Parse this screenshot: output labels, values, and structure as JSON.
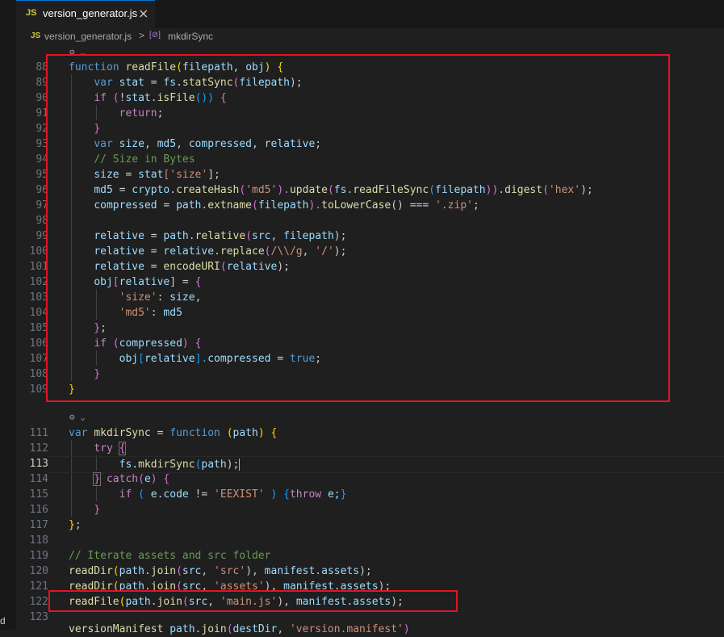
{
  "tab": {
    "badge": "JS",
    "title": "version_generator.js",
    "close": "×"
  },
  "breadcrumb": {
    "badge": "JS",
    "file": "version_generator.js",
    "separator": ">",
    "symbol_icon": "[⊘]",
    "symbol": "mkdirSync"
  },
  "codelens": {
    "icon": "⚙",
    "chevron": "⌄"
  },
  "stray_char": "d",
  "gutter": {
    "l88": "88",
    "l89": "89",
    "l90": "90",
    "l91": "91",
    "l92": "92",
    "l93": "93",
    "l94": "94",
    "l95": "95",
    "l96": "96",
    "l97": "97",
    "l98": "98",
    "l99": "99",
    "l100": "100",
    "l101": "101",
    "l102": "102",
    "l103": "103",
    "l104": "104",
    "l105": "105",
    "l106": "106",
    "l107": "107",
    "l108": "108",
    "l109": "109",
    "l111": "111",
    "l112": "112",
    "l113": "113",
    "l114": "114",
    "l115": "115",
    "l116": "116",
    "l117": "117",
    "l118": "118",
    "l119": "119",
    "l120": "120",
    "l121": "121",
    "l122": "122",
    "l123": "123"
  },
  "code": {
    "l88": [
      "function",
      "readFile",
      "(",
      "filepath",
      ", ",
      "obj",
      ") ",
      "{"
    ],
    "l89": [
      "    ",
      "var",
      "stat",
      " = ",
      "fs",
      ".",
      "statSync",
      "(",
      "filepath",
      ");"
    ],
    "l90": [
      "    ",
      "if",
      " (",
      "!",
      "stat",
      ".",
      "isFile",
      "()) ",
      "{"
    ],
    "l91": [
      "        ",
      "return",
      ";"
    ],
    "l92": [
      "    ",
      "}"
    ],
    "l93": [
      "    ",
      "var",
      "size",
      ", ",
      "md5",
      ", ",
      "compressed",
      ", ",
      "relative",
      ";"
    ],
    "l94": [
      "    ",
      "// Size in Bytes"
    ],
    "l95": [
      "    ",
      "size",
      " = ",
      "stat",
      "['size'",
      "];"
    ],
    "l96": [
      "    ",
      "md5",
      " = ",
      "crypto",
      ".",
      "createHash",
      "(",
      "'md5'",
      ").",
      "update",
      "(",
      "fs",
      ".",
      "readFileSync",
      "(",
      "filepath",
      "))",
      ".",
      "digest",
      "(",
      "'hex'",
      ");"
    ],
    "l97": [
      "    ",
      "compressed",
      " = ",
      "path",
      ".",
      "extname",
      "(",
      "filepath",
      ").",
      "toLowerCase",
      "() === ",
      "'.zip'",
      ";"
    ],
    "l99": [
      "    ",
      "relative",
      " = ",
      "path",
      ".",
      "relative",
      "(",
      "src",
      ", ",
      "filepath",
      ");"
    ],
    "l100": [
      "    ",
      "relative",
      " = ",
      "relative",
      ".",
      "replace",
      "(",
      "/\\\\/g",
      ", ",
      "'/'",
      ");"
    ],
    "l101": [
      "    ",
      "relative",
      " = ",
      "encodeURI",
      "(",
      "relative",
      ");"
    ],
    "l102": [
      "    ",
      "obj",
      "[",
      "relative",
      "] = ",
      "{"
    ],
    "l103": [
      "        ",
      "'size'",
      ": ",
      "size",
      ","
    ],
    "l104": [
      "        ",
      "'md5'",
      ": ",
      "md5"
    ],
    "l105": [
      "    ",
      "}",
      ";"
    ],
    "l106": [
      "    ",
      "if",
      " (",
      "compressed",
      ") ",
      "{"
    ],
    "l107": [
      "        ",
      "obj",
      "[",
      "relative",
      "].",
      "compressed",
      " = ",
      "true",
      ";"
    ],
    "l108": [
      "    ",
      "}"
    ],
    "l109": [
      "}"
    ],
    "l111": [
      "var ",
      "mkdirSync",
      " = ",
      "function",
      " (",
      "path",
      ") ",
      "{"
    ],
    "l112": [
      "    ",
      "try",
      " ",
      "{"
    ],
    "l113": [
      "        ",
      "fs",
      ".",
      "mkdirSync",
      "(",
      "path",
      ");"
    ],
    "l114": [
      "    ",
      "}",
      " ",
      "catch",
      "(",
      "e",
      ") ",
      "{"
    ],
    "l115": [
      "        ",
      "if",
      " ( ",
      "e",
      ".",
      "code",
      " != ",
      "'EEXIST'",
      " ) ",
      "{",
      "throw",
      " e;",
      "}"
    ],
    "l116": [
      "    ",
      "}"
    ],
    "l117": [
      "}",
      ";"
    ],
    "l119": [
      "// Iterate assets and src folder"
    ],
    "l120": [
      "readDir",
      "(",
      "path",
      ".",
      "join",
      "(",
      "src",
      ", ",
      "'src'",
      "), ",
      "manifest",
      ".",
      "assets",
      ");"
    ],
    "l121": [
      "readDir",
      "(",
      "path",
      ".",
      "join",
      "(",
      "src",
      ", ",
      "'assets'",
      "), ",
      "manifest",
      ".",
      "assets",
      ");"
    ],
    "l122": [
      "readFile",
      "(",
      "path",
      ".",
      "join",
      "(",
      "src",
      ", ",
      "'main.js'",
      "), ",
      "manifest",
      ".",
      "assets",
      ");"
    ],
    "l123": [
      "versionManifest",
      "path",
      ".",
      "join",
      "(",
      "destDir",
      ", ",
      "'version.manifest'",
      ")"
    ]
  }
}
